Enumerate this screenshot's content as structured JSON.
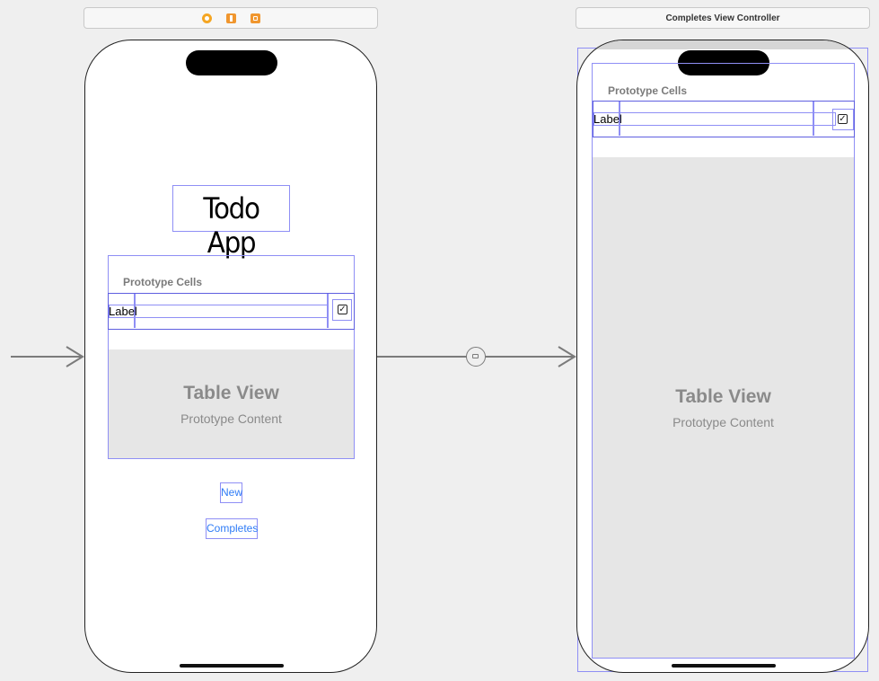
{
  "scene2": {
    "title": "Completes View Controller"
  },
  "scene1_icons": [
    "view-controller-icon",
    "first-responder-icon",
    "exit-icon"
  ],
  "main_vc": {
    "app_title": "Todo App",
    "table": {
      "prototype_header": "Prototype Cells",
      "cell_label": "Label",
      "placeholder_title": "Table View",
      "placeholder_subtitle": "Prototype Content"
    },
    "new_button": "New",
    "completes_button": "Completes"
  },
  "completes_vc": {
    "table": {
      "prototype_header": "Prototype Cells",
      "cell_label": "Label",
      "placeholder_title": "Table View",
      "placeholder_subtitle": "Prototype Content"
    }
  },
  "colors": {
    "canvas": "#efefef",
    "outline": "#8f8ff5",
    "link": "#2f7cf6",
    "dock_icon": "#f0962e"
  }
}
